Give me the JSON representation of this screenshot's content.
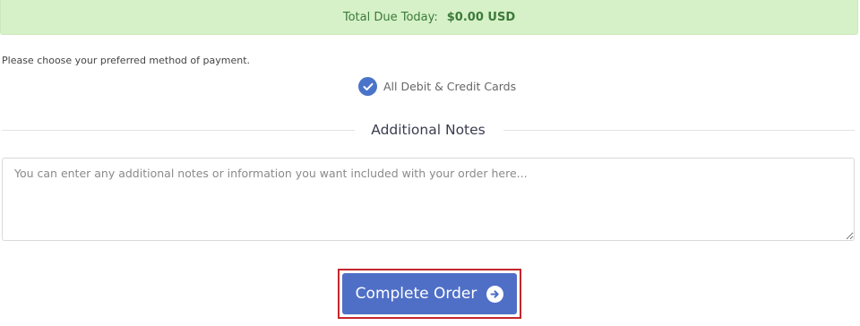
{
  "summary": {
    "total_label": "Total Due Today:",
    "total_amount": "$0.00 USD"
  },
  "payment": {
    "prompt": "Please choose your preferred method of payment.",
    "selected_method": "All Debit & Credit Cards",
    "check_icon": "check-icon"
  },
  "notes": {
    "title": "Additional Notes",
    "placeholder": "You can enter any additional notes or information you want included with your order here...",
    "value": ""
  },
  "actions": {
    "complete_label": "Complete Order",
    "complete_icon": "arrow-right-circle-icon"
  },
  "colors": {
    "success_bg": "#d6f1c8",
    "success_text": "#3c7a3a",
    "accent": "#4f6fc7",
    "highlight_border": "#c4272e"
  }
}
